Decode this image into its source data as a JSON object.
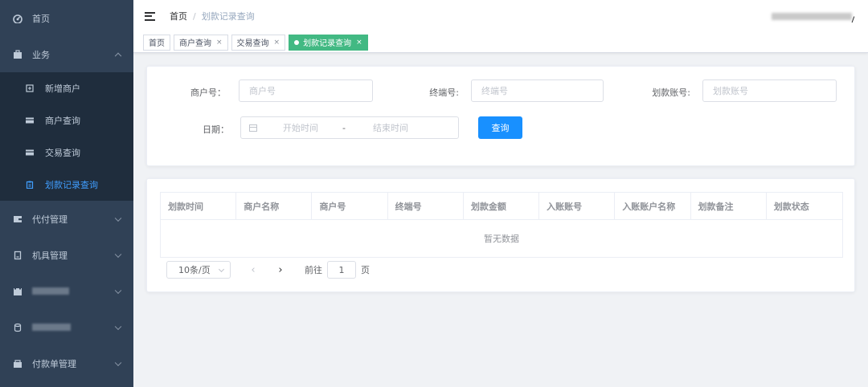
{
  "sidebar": {
    "background": "#304156",
    "active_color": "#409eff",
    "items": [
      {
        "label": "首页",
        "icon": "dashboard-icon"
      },
      {
        "label": "业务",
        "icon": "briefcase-icon",
        "expanded": true
      },
      {
        "label": "代付管理",
        "icon": "wallet-icon"
      },
      {
        "label": "机具管理",
        "icon": "device-icon"
      },
      {
        "label": "",
        "icon": "clipboard-icon",
        "blurred": true
      },
      {
        "label": "",
        "icon": "database-icon",
        "blurred": true
      },
      {
        "label": "付款单管理",
        "icon": "bill-icon"
      }
    ],
    "sub_items": [
      {
        "label": "新增商户",
        "icon": "add-merchant-icon"
      },
      {
        "label": "商户查询",
        "icon": "card-icon"
      },
      {
        "label": "交易查询",
        "icon": "card-icon"
      },
      {
        "label": "划款记录查询",
        "icon": "record-icon",
        "active": true
      }
    ]
  },
  "header": {
    "breadcrumb": {
      "home": "首页",
      "separator": "/",
      "current": "划款记录查询"
    }
  },
  "tags": [
    {
      "label": "首页",
      "closable": false
    },
    {
      "label": "商户查询",
      "closable": true
    },
    {
      "label": "交易查询",
      "closable": true
    },
    {
      "label": "划款记录查询",
      "closable": true,
      "active": true
    }
  ],
  "tag_close": "×",
  "search": {
    "merchant_no_label": "商户号：",
    "merchant_no_placeholder": "商户号",
    "terminal_no_label": "终端号:",
    "terminal_no_placeholder": "终端号",
    "account_label": "划款账号:",
    "account_placeholder": "划款账号",
    "date_label": "日期：",
    "start_placeholder": "开始时间",
    "range_separator": "-",
    "end_placeholder": "结束时间",
    "query_button": "查询"
  },
  "table": {
    "columns": [
      "划款时间",
      "商户名称",
      "商户号",
      "终端号",
      "划款金额",
      "入账账号",
      "入账账户名称",
      "划款备注",
      "划款状态"
    ],
    "empty_text": "暂无数据"
  },
  "pagination": {
    "page_size": "10条/页",
    "prev": "‹",
    "next": "›",
    "goto_label": "前往",
    "current_page": "1",
    "page_suffix": "页"
  }
}
